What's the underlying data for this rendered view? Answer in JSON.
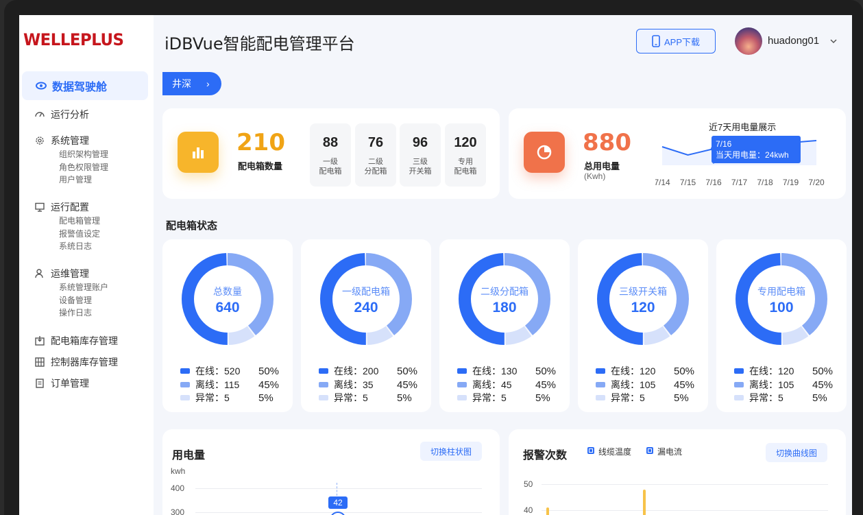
{
  "app": {
    "logo": "WELLEPLUS",
    "title": "iDBVue智能配电管理平台",
    "app_download": "APP下载",
    "username": "huadong01"
  },
  "sidebar": {
    "active": "数据驾驶舱",
    "groups": [
      {
        "label": "运行分析",
        "icon": "gauge-icon",
        "items": []
      },
      {
        "label": "系统管理",
        "icon": "gear-icon",
        "items": [
          "组织架构管理",
          "角色权限管理",
          "用户管理"
        ]
      },
      {
        "label": "运行配置",
        "icon": "monitor-icon",
        "items": [
          "配电箱管理",
          "报警值设定",
          "系统日志"
        ]
      },
      {
        "label": "运维管理",
        "icon": "user-icon",
        "items": [
          "系统管理账户",
          "设备管理",
          "操作日志"
        ]
      },
      {
        "label": "配电箱库存管理",
        "icon": "inbox-icon",
        "items": []
      },
      {
        "label": "控制器库存管理",
        "icon": "grid-icon",
        "items": []
      },
      {
        "label": "订单管理",
        "icon": "doc-icon",
        "items": []
      }
    ]
  },
  "breadcrumb": {
    "label": "井深"
  },
  "summary": {
    "boxes": {
      "value": "210",
      "label": "配电箱数量"
    },
    "mini": [
      {
        "value": "88",
        "label": "一级\n配电箱"
      },
      {
        "value": "76",
        "label": "二级\n分配箱"
      },
      {
        "value": "96",
        "label": "三级\n开关箱"
      },
      {
        "value": "120",
        "label": "专用\n配电箱"
      }
    ],
    "power": {
      "value": "880",
      "label": "总用电量",
      "unit": "(Kwh)"
    },
    "trend": {
      "title": "近7天用电量展示",
      "days": [
        "7/14",
        "7/15",
        "7/16",
        "7/17",
        "7/18",
        "7/19",
        "7/20"
      ],
      "tooltip_date": "7/16",
      "tooltip_text": "当天用电量：24kwh"
    }
  },
  "status": {
    "title": "配电箱状态",
    "labels": {
      "online": "在线：",
      "offline": "离线：",
      "abnormal": "异常："
    },
    "cards": [
      {
        "name": "总数量",
        "total": "640",
        "online": "520",
        "online_pct": "50%",
        "offline": "115",
        "offline_pct": "45%",
        "abnormal": "5",
        "abnormal_pct": "5%"
      },
      {
        "name": "一级配电箱",
        "total": "240",
        "online": "200",
        "online_pct": "50%",
        "offline": "35",
        "offline_pct": "45%",
        "abnormal": "5",
        "abnormal_pct": "5%"
      },
      {
        "name": "二级分配箱",
        "total": "180",
        "online": "130",
        "online_pct": "50%",
        "offline": "45",
        "offline_pct": "45%",
        "abnormal": "5",
        "abnormal_pct": "5%"
      },
      {
        "name": "三级开关箱",
        "total": "120",
        "online": "120",
        "online_pct": "50%",
        "offline": "105",
        "offline_pct": "45%",
        "abnormal": "5",
        "abnormal_pct": "5%"
      },
      {
        "name": "专用配电箱",
        "total": "100",
        "online": "120",
        "online_pct": "50%",
        "offline": "105",
        "offline_pct": "45%",
        "abnormal": "5",
        "abnormal_pct": "5%"
      }
    ]
  },
  "usage_chart": {
    "title": "用电量",
    "switch": "切换柱状图",
    "unit": "kwh",
    "ticks": [
      "400",
      "300"
    ],
    "marker": "42"
  },
  "alarm_chart": {
    "title": "报警次数",
    "legend": [
      "线缆温度",
      "漏电流"
    ],
    "switch": "切换曲线图",
    "ticks": [
      "50",
      "40"
    ]
  },
  "colors": {
    "primary": "#2c6cf6",
    "orange": "#f0724a",
    "yellow": "#f7b52b",
    "logo_red": "#c6161d"
  }
}
